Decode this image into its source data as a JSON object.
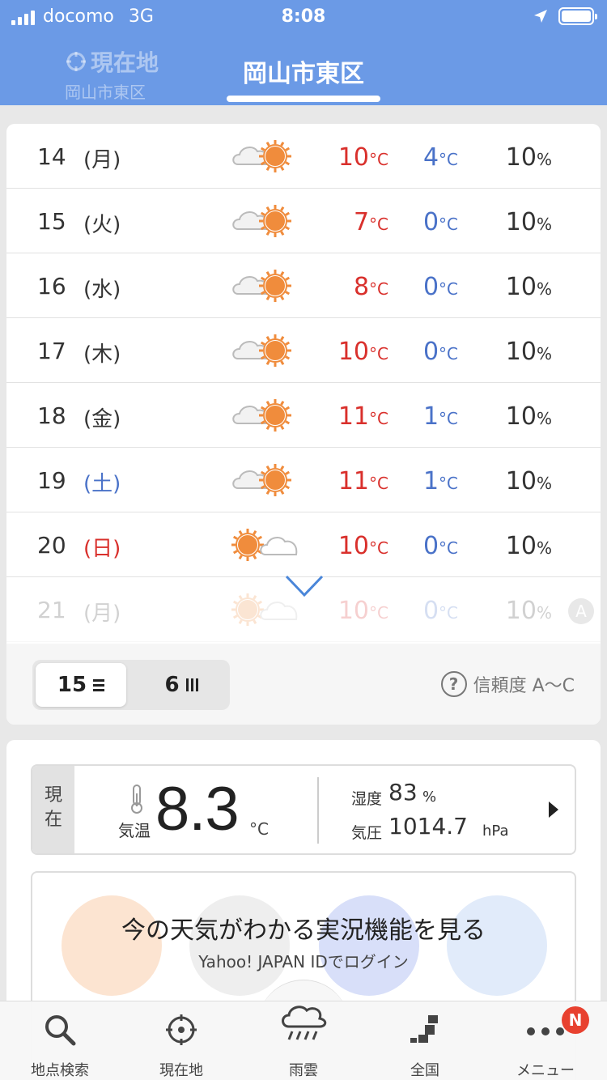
{
  "status_bar": {
    "carrier": "docomo",
    "network": "3G",
    "time": "8:08"
  },
  "header": {
    "location_tab": {
      "title": "現在地",
      "subtitle": "岡山市東区"
    },
    "active_tab": "岡山市東区"
  },
  "forecast": {
    "rows": [
      {
        "day": "14",
        "dow": "(月)",
        "icon": "cloud-sun-icon",
        "hi": "10",
        "lo": "4",
        "pop": "10"
      },
      {
        "day": "15",
        "dow": "(火)",
        "icon": "cloud-sun-icon",
        "hi": "7",
        "lo": "0",
        "pop": "10"
      },
      {
        "day": "16",
        "dow": "(水)",
        "icon": "cloud-sun-icon",
        "hi": "8",
        "lo": "0",
        "pop": "10"
      },
      {
        "day": "17",
        "dow": "(木)",
        "icon": "cloud-sun-icon",
        "hi": "10",
        "lo": "0",
        "pop": "10"
      },
      {
        "day": "18",
        "dow": "(金)",
        "icon": "cloud-sun-icon",
        "hi": "11",
        "lo": "1",
        "pop": "10"
      },
      {
        "day": "19",
        "dow": "(土)",
        "icon": "cloud-sun-icon",
        "hi": "11",
        "lo": "1",
        "pop": "10"
      },
      {
        "day": "20",
        "dow": "(日)",
        "icon": "sun-cloud-icon",
        "hi": "10",
        "lo": "0",
        "pop": "10"
      },
      {
        "day": "21",
        "dow": "(月)",
        "icon": "sun-cloud-icon",
        "hi": "10",
        "lo": "0",
        "pop": "10"
      }
    ],
    "temp_unit": "°C",
    "pop_unit": "%",
    "reliability_badge": "A",
    "toggle": {
      "option1": "15",
      "option2": "6"
    },
    "reliability": "信頼度 A〜C",
    "reliability_q": "?"
  },
  "current": {
    "label": "現在",
    "temp_label": "気温",
    "temp_value": "8.3",
    "temp_unit": "°C",
    "humidity_label": "湿度",
    "humidity_value": "83",
    "humidity_unit": "%",
    "pressure_label": "気圧",
    "pressure_value": "1014.7",
    "pressure_unit": "hPa"
  },
  "promo": {
    "title": "今の天気がわかる実況機能を見る",
    "subtitle": "Yahoo! JAPAN IDでログイン"
  },
  "bottom_nav": {
    "items": [
      {
        "label": "地点検索",
        "icon": "search-icon"
      },
      {
        "label": "現在地",
        "icon": "crosshair-icon"
      },
      {
        "label": "雨雲",
        "icon": "rain-cloud-icon"
      },
      {
        "label": "全国",
        "icon": "map-icon"
      },
      {
        "label": "メニュー",
        "icon": "more-icon"
      }
    ],
    "badge": "N"
  },
  "colors": {
    "header": "#6b9ae6",
    "high": "#d9302c",
    "low": "#4a72c8",
    "sun": "#f08c3c"
  }
}
